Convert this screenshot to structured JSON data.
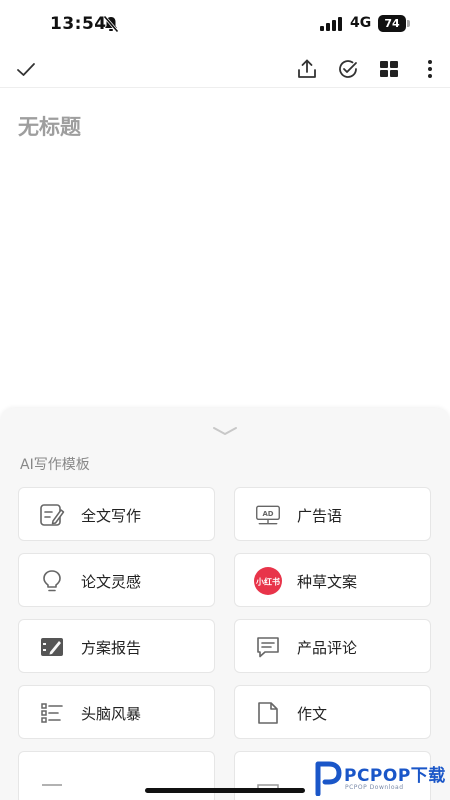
{
  "status_bar": {
    "time": "13:54",
    "network": "4G",
    "battery": "74"
  },
  "toolbar": {
    "icons": [
      "check-icon",
      "share-icon",
      "check-circle-icon",
      "grid-icon",
      "more-vertical-icon"
    ]
  },
  "document": {
    "title_placeholder": "无标题"
  },
  "templates": {
    "section_label": "AI写作模板",
    "items": [
      {
        "label": "全文写作",
        "icon": "edit-document-icon"
      },
      {
        "label": "广告语",
        "icon": "ad-monitor-icon"
      },
      {
        "label": "论文灵感",
        "icon": "lightbulb-icon"
      },
      {
        "label": "种草文案",
        "icon": "xiaohongshu-logo-icon",
        "logo_text": "小红书"
      },
      {
        "label": "方案报告",
        "icon": "report-icon"
      },
      {
        "label": "产品评论",
        "icon": "comment-icon"
      },
      {
        "label": "头脑风暴",
        "icon": "list-icon"
      },
      {
        "label": "作文",
        "icon": "page-icon"
      }
    ]
  },
  "watermark": {
    "brand": "PCPOP下载",
    "sub": "PCPOP Download"
  },
  "colors": {
    "accent_red": "#e8344a",
    "watermark_blue": "#1a56c8",
    "title_gray": "#9e9e9e"
  }
}
